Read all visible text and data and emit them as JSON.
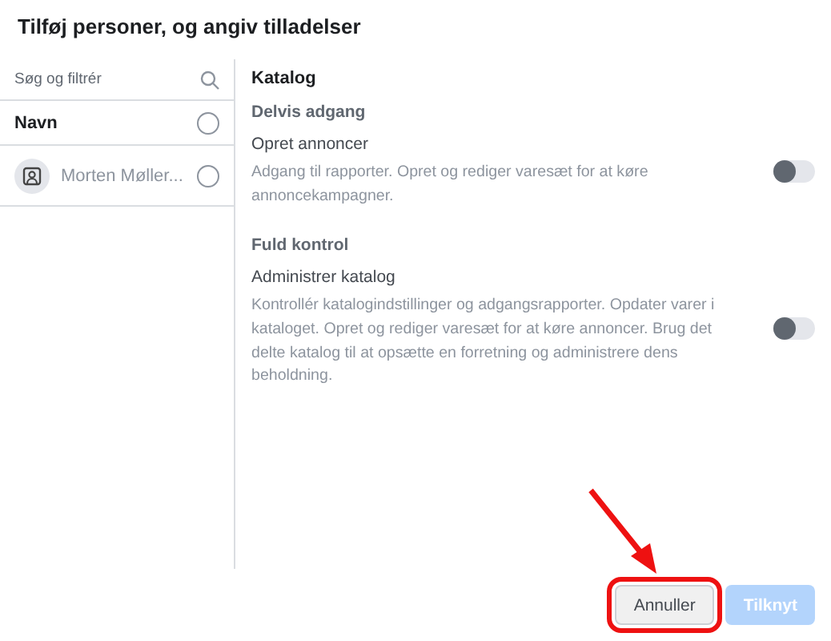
{
  "title": "Tilføj personer, og angiv tilladelser",
  "people": {
    "search": {
      "placeholder": "Søg og filtrér"
    },
    "header": {
      "label": "Navn",
      "selected": false
    },
    "rows": [
      {
        "name": "Morten Møller...",
        "selected": false
      }
    ]
  },
  "permissions": {
    "heading": "Katalog",
    "groups": [
      {
        "title": "Delvis adgang",
        "items": [
          {
            "name": "Opret annoncer",
            "description": "Adgang til rapporter. Opret og rediger varesæt for at køre annoncekampagner.",
            "on": false
          }
        ]
      },
      {
        "title": "Fuld kontrol",
        "items": [
          {
            "name": "Administrer katalog",
            "description": "Kontrollér katalogindstillinger og adgangsrapporter. Opdater varer i kataloget. Opret og rediger varesæt for at køre annoncer. Brug det delte katalog til at opsætte en forretning og administrere dens beholdning.",
            "on": false
          }
        ]
      }
    ]
  },
  "buttons": [
    {
      "label": "Annuller",
      "kind": "secondary",
      "disabled": false,
      "highlighted": true
    },
    {
      "label": "Tilknyt",
      "kind": "primary",
      "disabled": true,
      "highlighted": false
    }
  ]
}
